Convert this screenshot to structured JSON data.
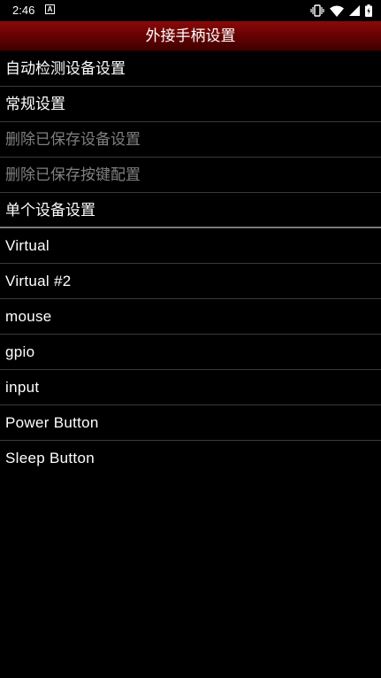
{
  "status_bar": {
    "time": "2:46",
    "notification_glyph": "A",
    "icons": [
      "vibrate-icon",
      "wifi-icon",
      "signal-icon",
      "battery-icon"
    ]
  },
  "title_bar": {
    "title": "外接手柄设置"
  },
  "settings": [
    {
      "label": "自动检测设备设置",
      "enabled": true
    },
    {
      "label": "常规设置",
      "enabled": true
    },
    {
      "label": "删除已保存设备设置",
      "enabled": false
    },
    {
      "label": "删除已保存按键配置",
      "enabled": false
    },
    {
      "label": "单个设备设置",
      "enabled": true
    }
  ],
  "devices": [
    {
      "label": "Virtual"
    },
    {
      "label": "Virtual #2"
    },
    {
      "label": "mouse"
    },
    {
      "label": "gpio"
    },
    {
      "label": "input"
    },
    {
      "label": "Power Button"
    },
    {
      "label": "Sleep Button"
    }
  ],
  "colors": {
    "title_bar_top": "#8a0a0a",
    "title_bar_bottom": "#3e0000",
    "disabled_text": "#808080",
    "background": "#000000"
  }
}
